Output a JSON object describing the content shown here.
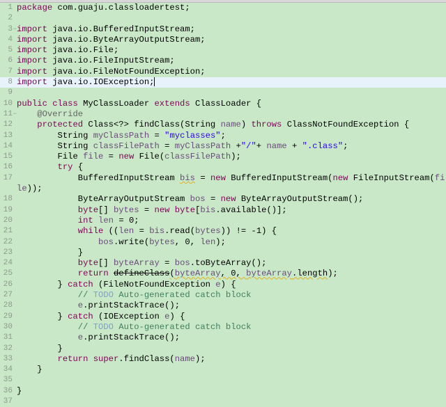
{
  "editor": {
    "colors": {
      "background": "#c9e8c8",
      "keyword": "#7f0055",
      "string": "#2a00ff",
      "variable": "#6a4a7a",
      "comment": "#3f7f5f",
      "todo": "#7f9fbf",
      "annotation": "#646464"
    },
    "current_line": 8,
    "folded_lines": [
      3,
      11
    ],
    "lines": [
      [
        [
          "k",
          "package"
        ],
        [
          "p",
          " com.guaju.classloadertest;"
        ]
      ],
      [],
      [
        [
          "k",
          "import"
        ],
        [
          "p",
          " java.io.BufferedInputStream;"
        ]
      ],
      [
        [
          "k",
          "import"
        ],
        [
          "p",
          " java.io.ByteArrayOutputStream;"
        ]
      ],
      [
        [
          "k",
          "import"
        ],
        [
          "p",
          " java.io.File;"
        ]
      ],
      [
        [
          "k",
          "import"
        ],
        [
          "p",
          " java.io.FileInputStream;"
        ]
      ],
      [
        [
          "k",
          "import"
        ],
        [
          "p",
          " java.io.FileNotFoundException;"
        ]
      ],
      [
        [
          "k",
          "import"
        ],
        [
          "p",
          " java.io.IOException;"
        ]
      ],
      [],
      [
        [
          "k",
          "public class"
        ],
        [
          "p",
          " MyClassLoader "
        ],
        [
          "k",
          "extends"
        ],
        [
          "p",
          " ClassLoader {"
        ]
      ],
      [
        [
          "p",
          "    "
        ],
        [
          "a",
          "@Override"
        ]
      ],
      [
        [
          "p",
          "    "
        ],
        [
          "k",
          "protected"
        ],
        [
          "p",
          " Class<?> findClass(String "
        ],
        [
          "v",
          "name"
        ],
        [
          "p",
          ") "
        ],
        [
          "k",
          "throws"
        ],
        [
          "p",
          " ClassNotFoundException {"
        ]
      ],
      [
        [
          "p",
          "        String "
        ],
        [
          "v",
          "myClassPath"
        ],
        [
          "p",
          " = "
        ],
        [
          "s",
          "\"myclasses\""
        ],
        [
          "p",
          ";"
        ]
      ],
      [
        [
          "p",
          "        String "
        ],
        [
          "v",
          "classFilePath"
        ],
        [
          "p",
          " = "
        ],
        [
          "v",
          "myClassPath"
        ],
        [
          "p",
          " +"
        ],
        [
          "s",
          "\"/\""
        ],
        [
          "p",
          "+ "
        ],
        [
          "v",
          "name"
        ],
        [
          "p",
          " + "
        ],
        [
          "s",
          "\".class\""
        ],
        [
          "p",
          ";"
        ]
      ],
      [
        [
          "p",
          "        File "
        ],
        [
          "v",
          "file"
        ],
        [
          "p",
          " = "
        ],
        [
          "k",
          "new"
        ],
        [
          "p",
          " File("
        ],
        [
          "v",
          "classFilePath"
        ],
        [
          "p",
          ");"
        ]
      ],
      [
        [
          "p",
          "        "
        ],
        [
          "k",
          "try"
        ],
        [
          "p",
          " {"
        ]
      ],
      [
        [
          "p",
          "            BufferedInputStream "
        ],
        [
          "vw",
          "bis"
        ],
        [
          "p",
          " = "
        ],
        [
          "k",
          "new"
        ],
        [
          "p",
          " BufferedInputStream("
        ],
        [
          "k",
          "new"
        ],
        [
          "p",
          " FileInputStream("
        ],
        [
          "v",
          "file"
        ],
        [
          "p",
          "));"
        ]
      ],
      [
        [
          "p",
          "            ByteArrayOutputStream "
        ],
        [
          "v",
          "bos"
        ],
        [
          "p",
          " = "
        ],
        [
          "k",
          "new"
        ],
        [
          "p",
          " ByteArrayOutputStream();"
        ]
      ],
      [
        [
          "p",
          "            "
        ],
        [
          "k",
          "byte"
        ],
        [
          "p",
          "[] "
        ],
        [
          "v",
          "bytes"
        ],
        [
          "p",
          " = "
        ],
        [
          "k",
          "new byte"
        ],
        [
          "p",
          "["
        ],
        [
          "v",
          "bis"
        ],
        [
          "p",
          ".available()];"
        ]
      ],
      [
        [
          "p",
          "            "
        ],
        [
          "k",
          "int"
        ],
        [
          "p",
          " "
        ],
        [
          "v",
          "len"
        ],
        [
          "p",
          " = 0;"
        ]
      ],
      [
        [
          "p",
          "            "
        ],
        [
          "k",
          "while"
        ],
        [
          "p",
          " (("
        ],
        [
          "v",
          "len"
        ],
        [
          "p",
          " = "
        ],
        [
          "v",
          "bis"
        ],
        [
          "p",
          ".read("
        ],
        [
          "v",
          "bytes"
        ],
        [
          "p",
          ")) != -1) {"
        ]
      ],
      [
        [
          "p",
          "                "
        ],
        [
          "v",
          "bos"
        ],
        [
          "p",
          ".write("
        ],
        [
          "v",
          "bytes"
        ],
        [
          "p",
          ", 0, "
        ],
        [
          "v",
          "len"
        ],
        [
          "p",
          ");"
        ]
      ],
      [
        [
          "p",
          "            }"
        ]
      ],
      [
        [
          "p",
          "            "
        ],
        [
          "k",
          "byte"
        ],
        [
          "p",
          "[] "
        ],
        [
          "v",
          "byteArray"
        ],
        [
          "p",
          " = "
        ],
        [
          "v",
          "bos"
        ],
        [
          "p",
          ".toByteArray();"
        ]
      ],
      [
        [
          "p",
          "            "
        ],
        [
          "k",
          "return"
        ],
        [
          "p",
          " "
        ],
        [
          "d",
          "defineClass"
        ],
        [
          "pw",
          "("
        ],
        [
          "vw",
          "byteArray"
        ],
        [
          "pw",
          ", 0, "
        ],
        [
          "vw",
          "byteArray"
        ],
        [
          "pw",
          ".length"
        ],
        [
          "p",
          ");"
        ]
      ],
      [
        [
          "p",
          "        } "
        ],
        [
          "k",
          "catch"
        ],
        [
          "p",
          " (FileNotFoundException "
        ],
        [
          "v",
          "e"
        ],
        [
          "p",
          ") {"
        ]
      ],
      [
        [
          "p",
          "            "
        ],
        [
          "c",
          "// "
        ],
        [
          "t",
          "TODO"
        ],
        [
          "c",
          " Auto-generated catch block"
        ]
      ],
      [
        [
          "p",
          "            "
        ],
        [
          "v",
          "e"
        ],
        [
          "p",
          ".printStackTrace();"
        ]
      ],
      [
        [
          "p",
          "        } "
        ],
        [
          "k",
          "catch"
        ],
        [
          "p",
          " (IOException "
        ],
        [
          "v",
          "e"
        ],
        [
          "p",
          ") {"
        ]
      ],
      [
        [
          "p",
          "            "
        ],
        [
          "c",
          "// "
        ],
        [
          "t",
          "TODO"
        ],
        [
          "c",
          " Auto-generated catch block"
        ]
      ],
      [
        [
          "p",
          "            "
        ],
        [
          "v",
          "e"
        ],
        [
          "p",
          ".printStackTrace();"
        ]
      ],
      [
        [
          "p",
          "        }"
        ]
      ],
      [
        [
          "p",
          "        "
        ],
        [
          "k",
          "return super"
        ],
        [
          "p",
          ".findClass("
        ],
        [
          "v",
          "name"
        ],
        [
          "p",
          ");"
        ]
      ],
      [
        [
          "p",
          "    }"
        ]
      ],
      [],
      [
        [
          "p",
          "}"
        ]
      ],
      []
    ]
  }
}
